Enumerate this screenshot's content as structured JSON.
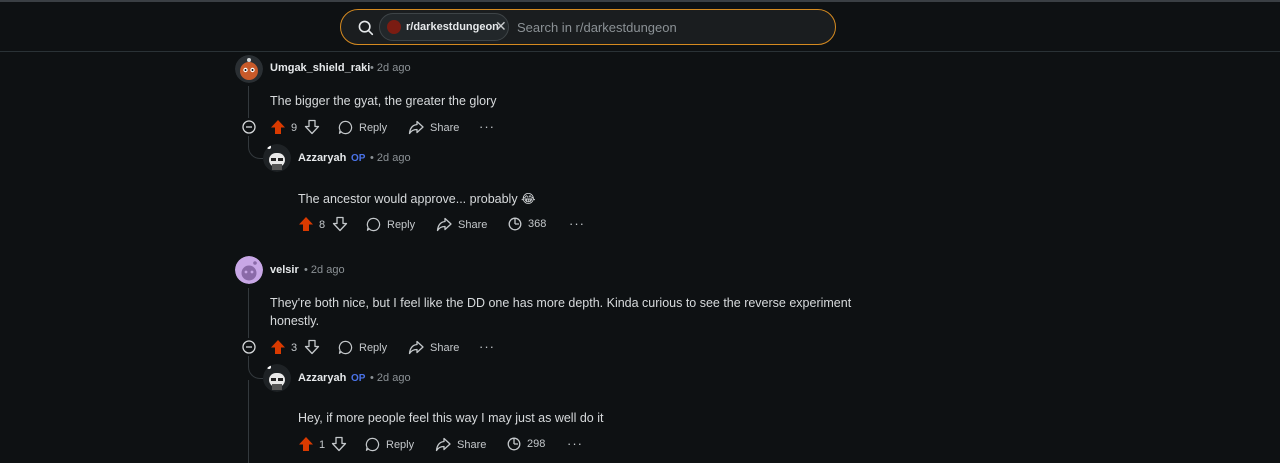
{
  "search": {
    "subreddit_chip": "r/darkestdungeon",
    "placeholder": "Search in r/darkestdungeon"
  },
  "colors": {
    "background": "#0e1113",
    "upvote_active": "#d93a00",
    "op_badge": "#4a73e8",
    "search_border": "#d58a20"
  },
  "comments": [
    {
      "author": "Umgak_shield_raki",
      "time": "2d ago",
      "text": "The bigger the gyat, the greater the glory",
      "score": "9",
      "reply_label": "Reply",
      "share_label": "Share",
      "more_label": "···"
    },
    {
      "author": "Azzaryah",
      "op_label": "OP",
      "time": "2d ago",
      "text": "The ancestor would approve... probably 😂",
      "score": "8",
      "reply_label": "Reply",
      "share_label": "Share",
      "views": "368",
      "more_label": "···"
    },
    {
      "author": "velsir",
      "time": "2d ago",
      "text": "They're both nice, but I feel like the DD one has more depth. Kinda curious to see the reverse experiment honestly.",
      "score": "3",
      "reply_label": "Reply",
      "share_label": "Share",
      "more_label": "···"
    },
    {
      "author": "Azzaryah",
      "op_label": "OP",
      "time": "2d ago",
      "text": "Hey, if more people feel this way I may just as well do it",
      "score": "1",
      "reply_label": "Reply",
      "share_label": "Share",
      "views": "298",
      "more_label": "···"
    }
  ]
}
